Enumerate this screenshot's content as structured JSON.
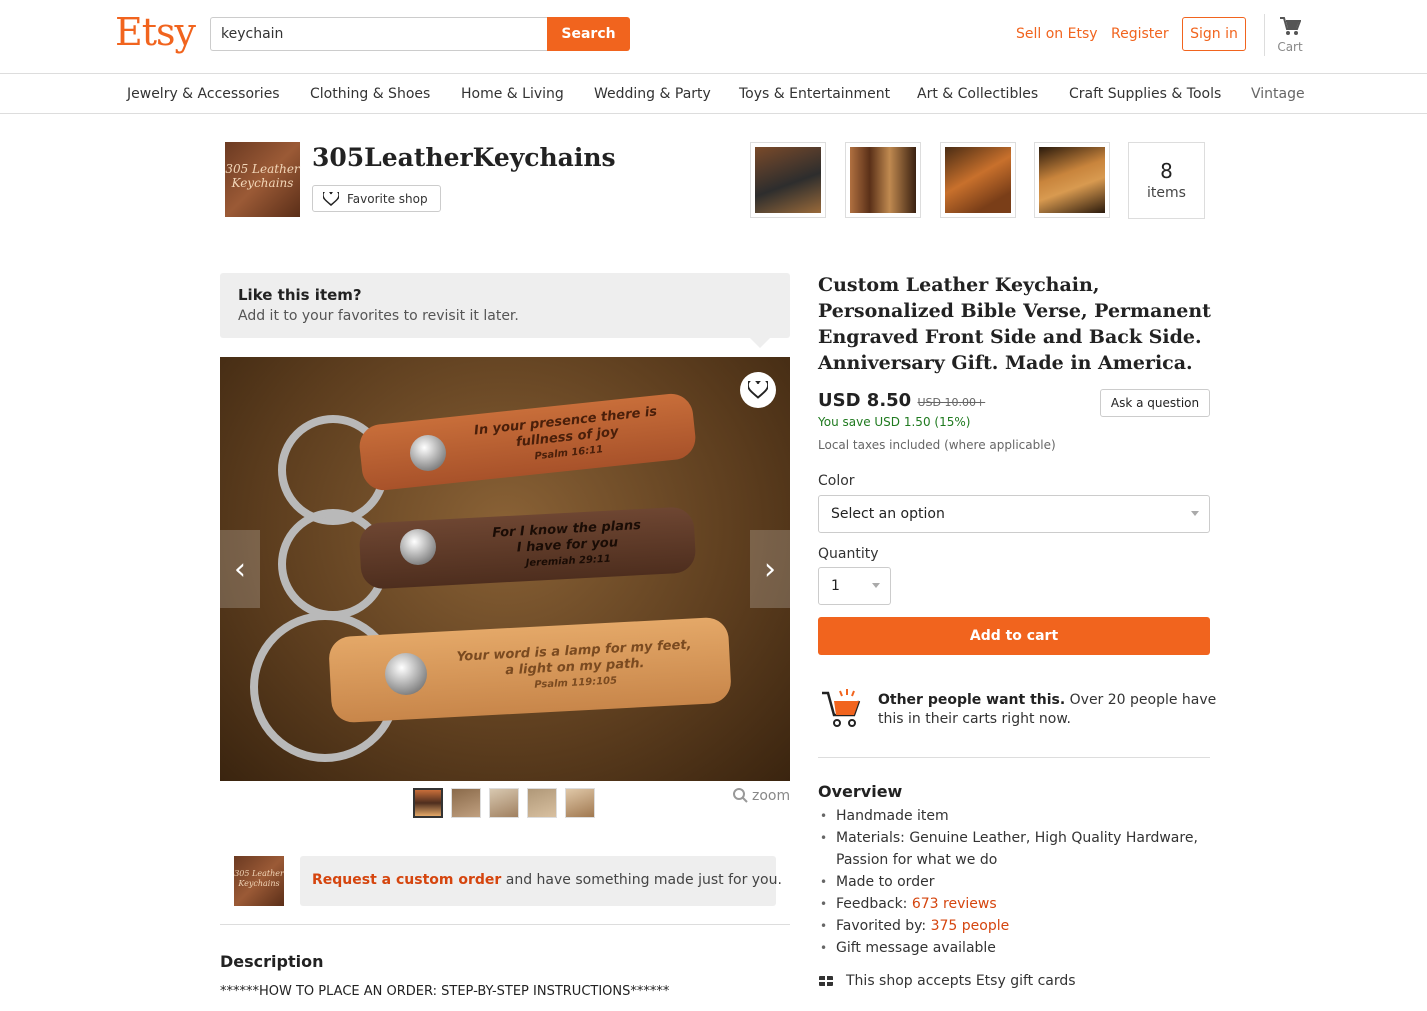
{
  "header": {
    "logo": "Etsy",
    "search_value": "keychain",
    "search_button": "Search",
    "sell_link": "Sell on Etsy",
    "register_link": "Register",
    "signin_button": "Sign in",
    "cart_label": "Cart",
    "accent_color": "#F1641E"
  },
  "categories": [
    "Jewelry & Accessories",
    "Clothing & Shoes",
    "Home & Living",
    "Wedding & Party",
    "Toys & Entertainment",
    "Art & Collectibles",
    "Craft Supplies & Tools",
    "Vintage"
  ],
  "shop": {
    "avatar_text": "305 Leather Keychains",
    "name": "305LeatherKeychains",
    "favorite_button": "Favorite shop",
    "items_count": "8",
    "items_label": "items"
  },
  "like_prompt": {
    "title": "Like this item?",
    "subtitle": "Add it to your favorites to revisit it later."
  },
  "image": {
    "tag1_line1": "In your presence there is",
    "tag1_line2": "fullness of joy",
    "tag1_line3": "Psalm 16:11",
    "tag2_line1": "For I know the plans",
    "tag2_line2": "I have for you",
    "tag2_line3": "Jeremiah 29:11",
    "tag3_line1": "Your word is a lamp for my feet,",
    "tag3_line2": "a light on my path.",
    "tag3_line3": "Psalm 119:105",
    "zoom_label": "zoom"
  },
  "custom_order": {
    "avatar_text": "305 Leather Keychains",
    "link_text": "Request a custom order",
    "rest_text": " and have something made just for you."
  },
  "description": {
    "title": "Description",
    "text": "******HOW TO PLACE AN ORDER: STEP-BY-STEP INSTRUCTIONS******"
  },
  "listing": {
    "title": "Custom Leather Keychain, Personalized Bible Verse, Permanent Engraved Front Side and Back Side. Anniversary Gift. Made in America.",
    "price": "USD 8.50",
    "original_price": "USD 10.00+",
    "ask_button": "Ask a question",
    "savings": "You save USD 1.50 (15%)",
    "taxes": "Local taxes included (where applicable)",
    "color_label": "Color",
    "color_placeholder": "Select an option",
    "quantity_label": "Quantity",
    "quantity_value": "1",
    "add_to_cart": "Add to cart",
    "demand_bold": "Other people want this.",
    "demand_rest": " Over 20 people have this in their carts right now."
  },
  "overview": {
    "title": "Overview",
    "items": [
      "Handmade item",
      "Materials: Genuine Leather, High Quality Hardware, Passion for what we do",
      "Made to order"
    ],
    "feedback_label": "Feedback: ",
    "feedback_link": "673 reviews",
    "favorited_label": "Favorited by: ",
    "favorited_link": "375 people",
    "gift_message": "Gift message available",
    "gift_cards": "This shop accepts Etsy gift cards"
  }
}
